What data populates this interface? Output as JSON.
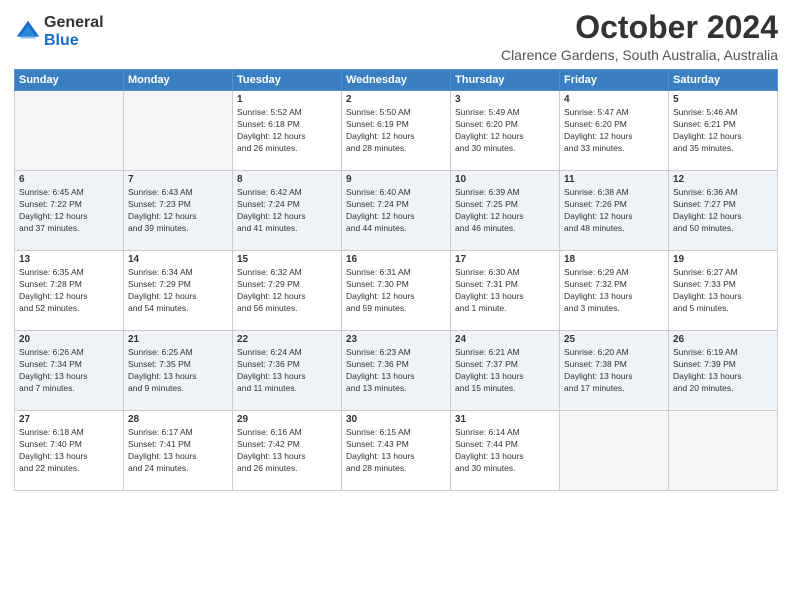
{
  "logo": {
    "line1": "General",
    "line2": "Blue"
  },
  "title": "October 2024",
  "subtitle": "Clarence Gardens, South Australia, Australia",
  "days_header": [
    "Sunday",
    "Monday",
    "Tuesday",
    "Wednesday",
    "Thursday",
    "Friday",
    "Saturday"
  ],
  "weeks": [
    [
      {
        "day": "",
        "info": ""
      },
      {
        "day": "",
        "info": ""
      },
      {
        "day": "1",
        "info": "Sunrise: 5:52 AM\nSunset: 6:18 PM\nDaylight: 12 hours\nand 26 minutes."
      },
      {
        "day": "2",
        "info": "Sunrise: 5:50 AM\nSunset: 6:19 PM\nDaylight: 12 hours\nand 28 minutes."
      },
      {
        "day": "3",
        "info": "Sunrise: 5:49 AM\nSunset: 6:20 PM\nDaylight: 12 hours\nand 30 minutes."
      },
      {
        "day": "4",
        "info": "Sunrise: 5:47 AM\nSunset: 6:20 PM\nDaylight: 12 hours\nand 33 minutes."
      },
      {
        "day": "5",
        "info": "Sunrise: 5:46 AM\nSunset: 6:21 PM\nDaylight: 12 hours\nand 35 minutes."
      }
    ],
    [
      {
        "day": "6",
        "info": "Sunrise: 6:45 AM\nSunset: 7:22 PM\nDaylight: 12 hours\nand 37 minutes."
      },
      {
        "day": "7",
        "info": "Sunrise: 6:43 AM\nSunset: 7:23 PM\nDaylight: 12 hours\nand 39 minutes."
      },
      {
        "day": "8",
        "info": "Sunrise: 6:42 AM\nSunset: 7:24 PM\nDaylight: 12 hours\nand 41 minutes."
      },
      {
        "day": "9",
        "info": "Sunrise: 6:40 AM\nSunset: 7:24 PM\nDaylight: 12 hours\nand 44 minutes."
      },
      {
        "day": "10",
        "info": "Sunrise: 6:39 AM\nSunset: 7:25 PM\nDaylight: 12 hours\nand 46 minutes."
      },
      {
        "day": "11",
        "info": "Sunrise: 6:38 AM\nSunset: 7:26 PM\nDaylight: 12 hours\nand 48 minutes."
      },
      {
        "day": "12",
        "info": "Sunrise: 6:36 AM\nSunset: 7:27 PM\nDaylight: 12 hours\nand 50 minutes."
      }
    ],
    [
      {
        "day": "13",
        "info": "Sunrise: 6:35 AM\nSunset: 7:28 PM\nDaylight: 12 hours\nand 52 minutes."
      },
      {
        "day": "14",
        "info": "Sunrise: 6:34 AM\nSunset: 7:29 PM\nDaylight: 12 hours\nand 54 minutes."
      },
      {
        "day": "15",
        "info": "Sunrise: 6:32 AM\nSunset: 7:29 PM\nDaylight: 12 hours\nand 56 minutes."
      },
      {
        "day": "16",
        "info": "Sunrise: 6:31 AM\nSunset: 7:30 PM\nDaylight: 12 hours\nand 59 minutes."
      },
      {
        "day": "17",
        "info": "Sunrise: 6:30 AM\nSunset: 7:31 PM\nDaylight: 13 hours\nand 1 minute."
      },
      {
        "day": "18",
        "info": "Sunrise: 6:29 AM\nSunset: 7:32 PM\nDaylight: 13 hours\nand 3 minutes."
      },
      {
        "day": "19",
        "info": "Sunrise: 6:27 AM\nSunset: 7:33 PM\nDaylight: 13 hours\nand 5 minutes."
      }
    ],
    [
      {
        "day": "20",
        "info": "Sunrise: 6:26 AM\nSunset: 7:34 PM\nDaylight: 13 hours\nand 7 minutes."
      },
      {
        "day": "21",
        "info": "Sunrise: 6:25 AM\nSunset: 7:35 PM\nDaylight: 13 hours\nand 9 minutes."
      },
      {
        "day": "22",
        "info": "Sunrise: 6:24 AM\nSunset: 7:36 PM\nDaylight: 13 hours\nand 11 minutes."
      },
      {
        "day": "23",
        "info": "Sunrise: 6:23 AM\nSunset: 7:36 PM\nDaylight: 13 hours\nand 13 minutes."
      },
      {
        "day": "24",
        "info": "Sunrise: 6:21 AM\nSunset: 7:37 PM\nDaylight: 13 hours\nand 15 minutes."
      },
      {
        "day": "25",
        "info": "Sunrise: 6:20 AM\nSunset: 7:38 PM\nDaylight: 13 hours\nand 17 minutes."
      },
      {
        "day": "26",
        "info": "Sunrise: 6:19 AM\nSunset: 7:39 PM\nDaylight: 13 hours\nand 20 minutes."
      }
    ],
    [
      {
        "day": "27",
        "info": "Sunrise: 6:18 AM\nSunset: 7:40 PM\nDaylight: 13 hours\nand 22 minutes."
      },
      {
        "day": "28",
        "info": "Sunrise: 6:17 AM\nSunset: 7:41 PM\nDaylight: 13 hours\nand 24 minutes."
      },
      {
        "day": "29",
        "info": "Sunrise: 6:16 AM\nSunset: 7:42 PM\nDaylight: 13 hours\nand 26 minutes."
      },
      {
        "day": "30",
        "info": "Sunrise: 6:15 AM\nSunset: 7:43 PM\nDaylight: 13 hours\nand 28 minutes."
      },
      {
        "day": "31",
        "info": "Sunrise: 6:14 AM\nSunset: 7:44 PM\nDaylight: 13 hours\nand 30 minutes."
      },
      {
        "day": "",
        "info": ""
      },
      {
        "day": "",
        "info": ""
      }
    ]
  ]
}
